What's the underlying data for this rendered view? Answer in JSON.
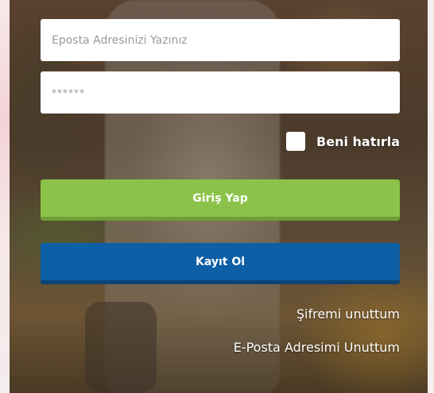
{
  "login_form": {
    "email_placeholder": "Eposta Adresinizi Yazınız",
    "password_placeholder": "******",
    "remember_label": "Beni hatırla",
    "login_button": "Giriş Yap",
    "register_button": "Kayıt Ol",
    "forgot_password_link": "Şifremi unuttum",
    "forgot_email_link": "E-Posta Adresimi Unuttum"
  },
  "colors": {
    "login_button": "#8bc34a",
    "register_button": "#0d5fa6",
    "text_light": "#ffffff"
  }
}
